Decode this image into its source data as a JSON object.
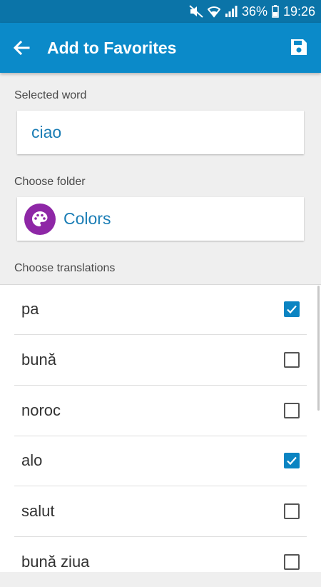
{
  "status": {
    "battery": "36%",
    "time": "19:26",
    "icons": [
      "mute-icon",
      "wifi-icon",
      "signal-icon",
      "battery-icon"
    ]
  },
  "app_bar": {
    "title": "Add to Favorites",
    "back_icon": "arrow-left-icon",
    "save_icon": "floppy-disk-icon",
    "color": "#0b8ac9"
  },
  "selected_word": {
    "label": "Selected word",
    "value": "ciao"
  },
  "folder": {
    "label": "Choose folder",
    "name": "Colors",
    "icon": "palette-icon",
    "icon_color": "#8e27a6"
  },
  "translations": {
    "label": "Choose translations",
    "items": [
      {
        "text": "pa",
        "checked": true
      },
      {
        "text": "bună",
        "checked": false
      },
      {
        "text": "noroc",
        "checked": false
      },
      {
        "text": "alo",
        "checked": true
      },
      {
        "text": "salut",
        "checked": false
      },
      {
        "text": "bună ziua",
        "checked": false
      }
    ]
  }
}
